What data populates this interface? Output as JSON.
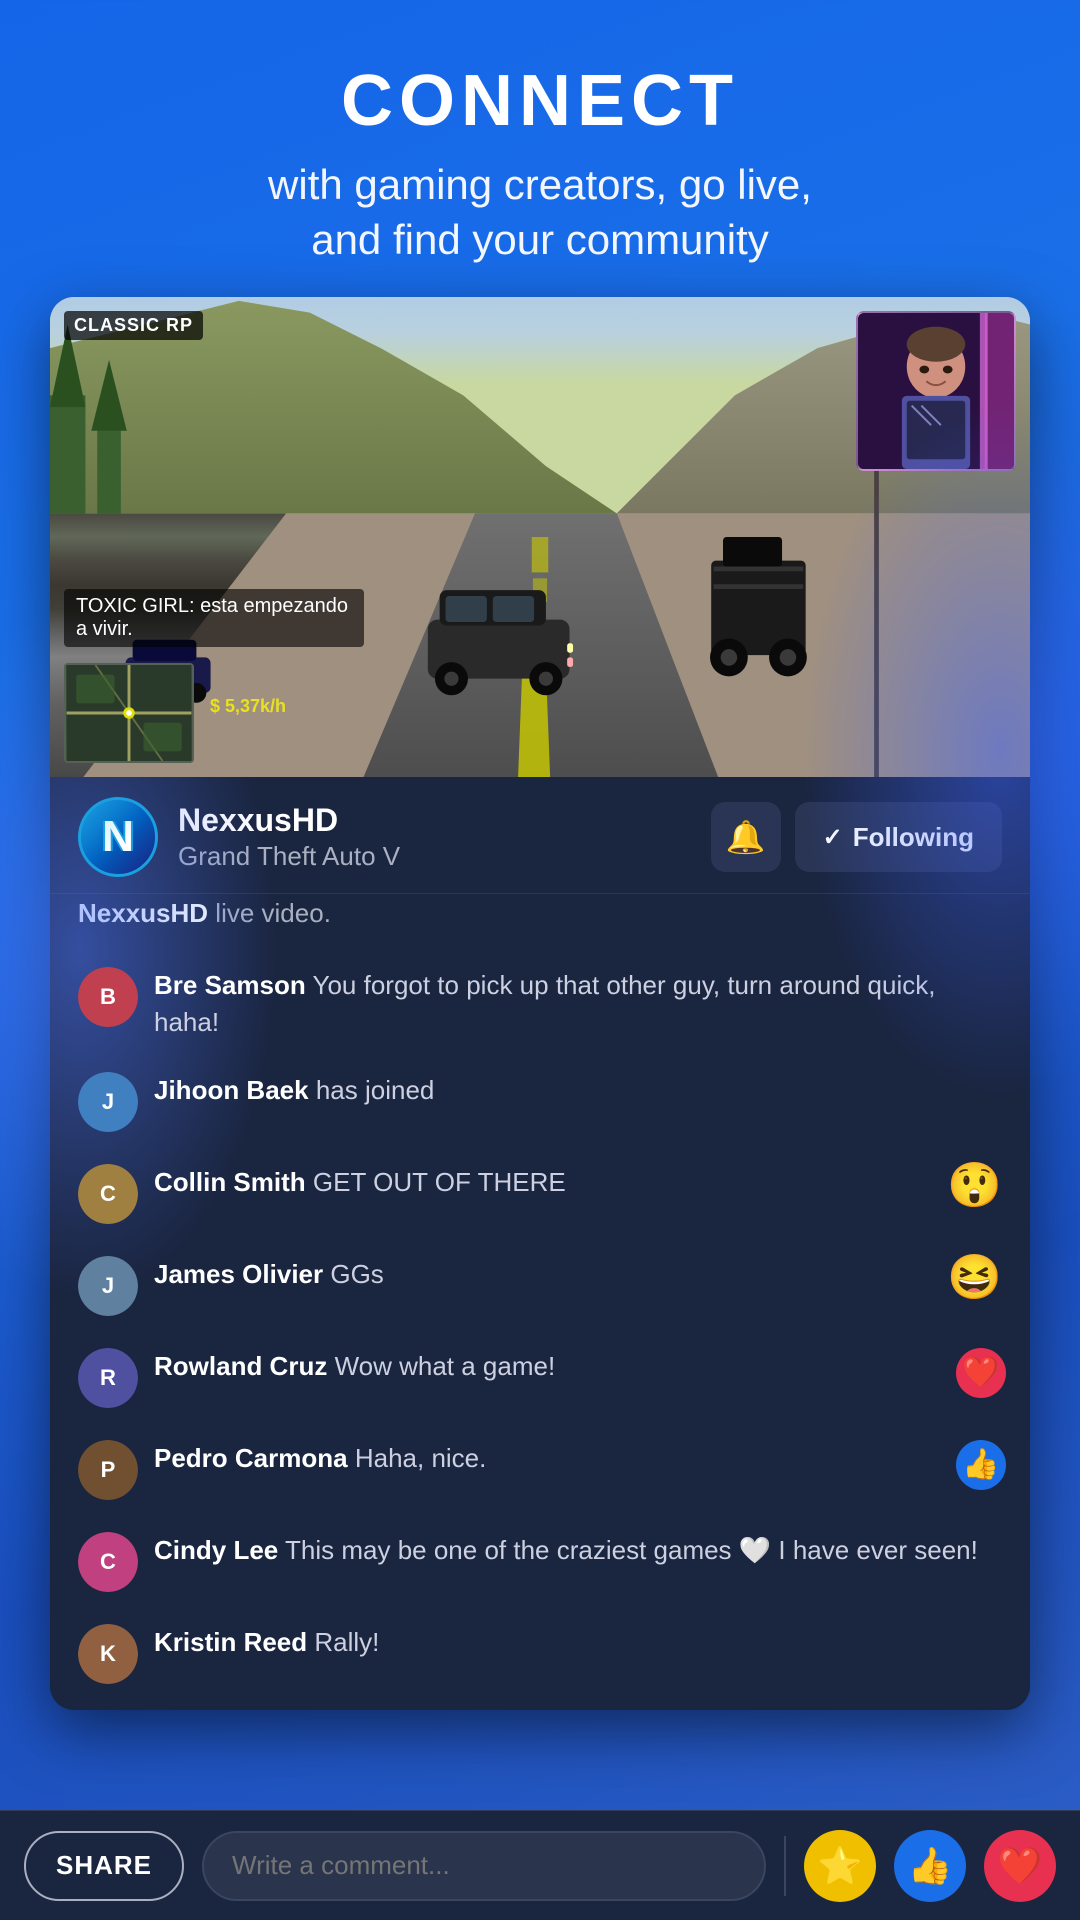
{
  "header": {
    "title": "CONNECT",
    "subtitle": "with gaming creators, go live,\nand find your community"
  },
  "game_overlay": {
    "label": "CLASSIC RP",
    "subtitles": "TOXIC GIRL: esta empezando\na vivir.",
    "speed": "$ 5,37k/h"
  },
  "streamer": {
    "name": "NexxusHD",
    "game": "Grand Theft Auto V",
    "live_text": "live video.",
    "avatar_letter": "N"
  },
  "actions": {
    "bell_icon": "🔔",
    "following_check": "✓",
    "following_label": "Following"
  },
  "comments": [
    {
      "id": "bre-samson",
      "name": "Bre Samson",
      "text": " You forgot to pick up that other guy, turn around quick, haha!",
      "avatar_color": "#c04050",
      "reaction": null
    },
    {
      "id": "jihoon-baek",
      "name": "Jihoon Baek",
      "text": " has joined",
      "avatar_color": "#4080c0",
      "reaction": null
    },
    {
      "id": "collin-smith",
      "name": "Collin Smith",
      "text": " GET OUT OF THERE",
      "avatar_color": "#a08040",
      "reaction": "😲"
    },
    {
      "id": "james-olivier",
      "name": "James Olivier",
      "text": " GGs",
      "avatar_color": "#6080a0",
      "reaction": "😆"
    },
    {
      "id": "rowland-cruz",
      "name": "Rowland Cruz",
      "text": " Wow what a game!",
      "avatar_color": "#5050a0",
      "reaction": "❤️"
    },
    {
      "id": "pedro-carmona",
      "name": "Pedro Carmona",
      "text": " Haha, nice.",
      "avatar_color": "#705030",
      "reaction": "👍"
    },
    {
      "id": "cindy-lee",
      "name": "Cindy Lee",
      "text": " This may be one of the craziest games 🤍 I have ever seen!",
      "avatar_color": "#c04080",
      "reaction": null
    },
    {
      "id": "kristin-reed",
      "name": "Kristin Reed",
      "text": " Rally!",
      "avatar_color": "#906040",
      "reaction": null
    }
  ],
  "bottom_bar": {
    "share_label": "SHARE",
    "comment_placeholder": "Write a comment...",
    "star_icon": "⭐",
    "like_icon": "👍",
    "heart_icon": "❤️"
  }
}
